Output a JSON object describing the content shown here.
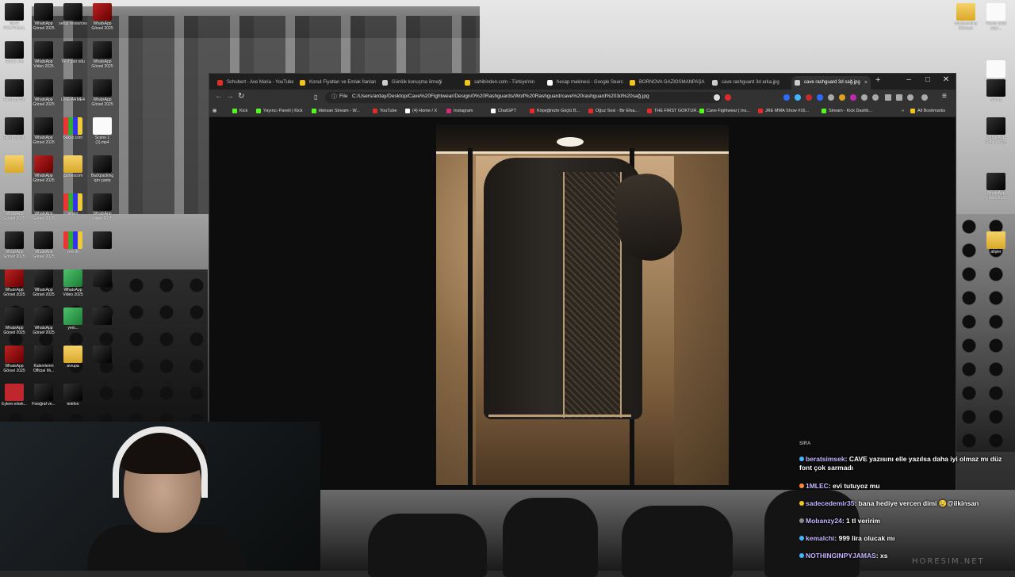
{
  "desktop": {
    "left_icons": [
      {
        "label": "NEW PROPOSAL",
        "color": "dark"
      },
      {
        "label": "WhatsApp Görsel 2025",
        "color": "dark"
      },
      {
        "label": "setup resources",
        "color": "dark"
      },
      {
        "label": "WhatsApp Görsel 2025",
        "color": "red"
      },
      {
        "label": "GÖZE ves",
        "color": "dark"
      },
      {
        "label": "WhatsApp Video 2025",
        "color": "dark"
      },
      {
        "label": "Tel it gun odu",
        "color": "dark"
      },
      {
        "label": "WhatsApp Görsel 2025",
        "color": "dark"
      },
      {
        "label": "Ekran görün",
        "color": "dark"
      },
      {
        "label": "WhatsApp Görsel 2025",
        "color": "dark"
      },
      {
        "label": "LIKE-ARME4",
        "color": "dark"
      },
      {
        "label": "WhatsApp Görsel 2025",
        "color": "dark"
      },
      {
        "label": "Ekran görün",
        "color": "dark"
      },
      {
        "label": "WhatsApp Görsel 2025",
        "color": "dark"
      },
      {
        "label": "bakso.com",
        "color": "multi"
      },
      {
        "label": "Scene 1 (3).mp4",
        "color": "doc"
      },
      {
        "label": "",
        "color": "folder"
      },
      {
        "label": "WhatsApp Görsel 2025",
        "color": "red"
      },
      {
        "label": "gamescom",
        "color": "folder"
      },
      {
        "label": "Backpacking için çanta",
        "color": "dark"
      },
      {
        "label": "WhatsApp Görsel 2025",
        "color": "dark"
      },
      {
        "label": "WhatsApp Görsel 2025",
        "color": "dark"
      },
      {
        "label": "afişler",
        "color": "multi"
      },
      {
        "label": "WhatsApp Video 2025",
        "color": "dark"
      },
      {
        "label": "WhatsApp Görsel 2025",
        "color": "dark"
      },
      {
        "label": "WhatsApp Görsel 2025",
        "color": "dark"
      },
      {
        "label": "yeni iki",
        "color": "multi"
      },
      {
        "label": "",
        "color": "dark"
      },
      {
        "label": "WhatsApp Görsel 2025",
        "color": "red"
      },
      {
        "label": "WhatsApp Görsel 2025",
        "color": "dark"
      },
      {
        "label": "WhatsApp Video 2025",
        "color": "green"
      },
      {
        "label": "",
        "color": "dark"
      },
      {
        "label": "WhatsApp Görsel 2025",
        "color": "dark"
      },
      {
        "label": "WhatsApp Görsel 2025",
        "color": "dark"
      },
      {
        "label": "yeni...",
        "color": "green"
      },
      {
        "label": "",
        "color": "dark"
      },
      {
        "label": "WhatsApp Görsel 2025",
        "color": "red"
      },
      {
        "label": "Kalemlerim Official Mi...",
        "color": "dark"
      },
      {
        "label": "avrupa",
        "color": "folder"
      },
      {
        "label": "",
        "color": "dark"
      },
      {
        "label": "Eylem erkek...",
        "color": "pdf"
      },
      {
        "label": "Fotoğraf ve...",
        "color": "dark"
      },
      {
        "label": "telefon",
        "color": "dark"
      }
    ],
    "right_icons": [
      {
        "label": "Backpacking Startups",
        "color": "folder"
      },
      {
        "label": "Yazılar dilek yapı...",
        "color": "doc"
      },
      {
        "label": "New Adobe Belgesi.ai",
        "color": "doc"
      },
      {
        "label": "Bering",
        "color": "dark"
      },
      {
        "label": "WhatsApp Görsel 2025",
        "color": "dark"
      },
      {
        "label": "WhatsApp Video 2025",
        "color": "dark"
      },
      {
        "label": "afişler",
        "color": "folder"
      }
    ]
  },
  "browser": {
    "tabs": [
      {
        "label": "Schubert - Ave Maria - YouTube",
        "color": "#e52d27",
        "active": false
      },
      {
        "label": "Konut Fiyatları ve Emlak İlanları",
        "color": "#f5c518",
        "active": false
      },
      {
        "label": "Günlük konuşma örneği",
        "color": "#cccccc",
        "active": false
      },
      {
        "label": "sahibinden.com - Türkiye'nin",
        "color": "#f5c518",
        "active": false
      },
      {
        "label": "hesap makinesi - Google Search",
        "color": "#ffffff",
        "active": false
      },
      {
        "label": "BORNOVA GAZİOSMANPAŞA",
        "color": "#f5c518",
        "active": false
      },
      {
        "label": "cave rashguard 3d arka.jpg",
        "color": "#cccccc",
        "active": false
      },
      {
        "label": "cave rashguard 3d sağ.jpg",
        "color": "#cccccc",
        "active": true
      }
    ],
    "new_tab": "+",
    "window_controls": {
      "minimize": "–",
      "maximize": "□",
      "close": "✕"
    },
    "omnibox": {
      "scheme_label": "File",
      "url": "C:/Users/arday/Desktop/Cave%20Fightwear/Design/0%20Rashguards/Wolf%20Rashguard/cave%20rashguard%203d%20sağ.jpg"
    },
    "bookmarks": [
      {
        "label": "Kick",
        "color": "#53fc18"
      },
      {
        "label": "Yayıncı Paneli | Kick",
        "color": "#53fc18"
      },
      {
        "label": "ilkinsan Stream - W...",
        "color": "#53fc18"
      },
      {
        "label": "YouTube",
        "color": "#e52d27"
      },
      {
        "label": "(4) Home / X",
        "color": "#ffffff"
      },
      {
        "label": "Instagram",
        "color": "#d62976"
      },
      {
        "label": "ChatGPT",
        "color": "#ffffff"
      },
      {
        "label": "Köpeğinizle Güçlü B...",
        "color": "#e52d27"
      },
      {
        "label": "Oğuz Sesi - Bir Efsa...",
        "color": "#e52d27"
      },
      {
        "label": "THE FIRST GOKTUR...",
        "color": "#e52d27"
      },
      {
        "label": "Cave Fightwear | Ins...",
        "color": "#53fc18"
      },
      {
        "label": "JRE MMA Show #16...",
        "color": "#e52d27"
      },
      {
        "label": "Stream - Kick Dashb...",
        "color": "#53fc18"
      }
    ],
    "all_bookmarks": "All Bookmarks"
  },
  "chat": {
    "partial_top": "SIRA",
    "messages": [
      {
        "user": "beratsimsek",
        "text": "CAVE yazısını elle yazılsa daha iyi olmaz mı düz font çok sarmadı",
        "badge": "#3fb6ff"
      },
      {
        "user": "1MLEC",
        "text": "evi tutuyoz mu",
        "badge": "#ff8a2b"
      },
      {
        "user": "sadecedemir35",
        "text": "bana hediye vercen dimi 😢@ilkinsan",
        "badge": "#f5c518"
      },
      {
        "user": "Mobanzy24",
        "text": "1 tl veririm",
        "badge": "#888888"
      },
      {
        "user": "kemalchi",
        "text": "999 lira olucak mı",
        "badge": "#3fb6ff"
      },
      {
        "user": "NOTHINGINPYJAMAS",
        "text": "xs",
        "badge": "#3fb6ff"
      }
    ]
  },
  "watermark": "HORESIM.NET"
}
